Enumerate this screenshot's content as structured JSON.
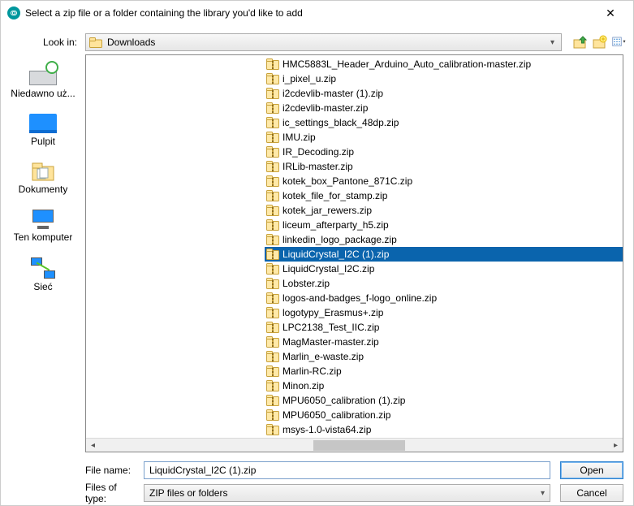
{
  "title": "Select a zip file or a folder containing the library you'd like to add",
  "lookin_label": "Look in:",
  "lookin_value": "Downloads",
  "sidebar": [
    {
      "label": "Niedawno uż..."
    },
    {
      "label": "Pulpit"
    },
    {
      "label": "Dokumenty"
    },
    {
      "label": "Ten komputer"
    },
    {
      "label": "Sieć"
    }
  ],
  "files": [
    {
      "name": "HMC5883L_Header_Arduino_Auto_calibration-master.zip"
    },
    {
      "name": "i_pixel_u.zip"
    },
    {
      "name": "i2cdevlib-master (1).zip"
    },
    {
      "name": "i2cdevlib-master.zip"
    },
    {
      "name": "ic_settings_black_48dp.zip"
    },
    {
      "name": "IMU.zip"
    },
    {
      "name": "IR_Decoding.zip"
    },
    {
      "name": "IRLib-master.zip"
    },
    {
      "name": "kotek_box_Pantone_871C.zip"
    },
    {
      "name": "kotek_file_for_stamp.zip"
    },
    {
      "name": "kotek_jar_rewers.zip"
    },
    {
      "name": "liceum_afterparty_h5.zip"
    },
    {
      "name": "linkedin_logo_package.zip"
    },
    {
      "name": "LiquidCrystal_I2C (1).zip",
      "selected": true
    },
    {
      "name": "LiquidCrystal_I2C.zip"
    },
    {
      "name": "Lobster.zip"
    },
    {
      "name": "logos-and-badges_f-logo_online.zip"
    },
    {
      "name": "logotypy_Erasmus+.zip"
    },
    {
      "name": "LPC2138_Test_IIC.zip"
    },
    {
      "name": "MagMaster-master.zip"
    },
    {
      "name": "Marlin_e-waste.zip"
    },
    {
      "name": "Marlin-RC.zip"
    },
    {
      "name": "Minon.zip"
    },
    {
      "name": "MPU6050_calibration (1).zip"
    },
    {
      "name": "MPU6050_calibration.zip"
    },
    {
      "name": "msys-1.0-vista64.zip"
    }
  ],
  "filename_label": "File name:",
  "filename_value": "LiquidCrystal_I2C (1).zip",
  "filetype_label": "Files of type:",
  "filetype_value": "ZIP files or folders",
  "open_label": "Open",
  "cancel_label": "Cancel"
}
